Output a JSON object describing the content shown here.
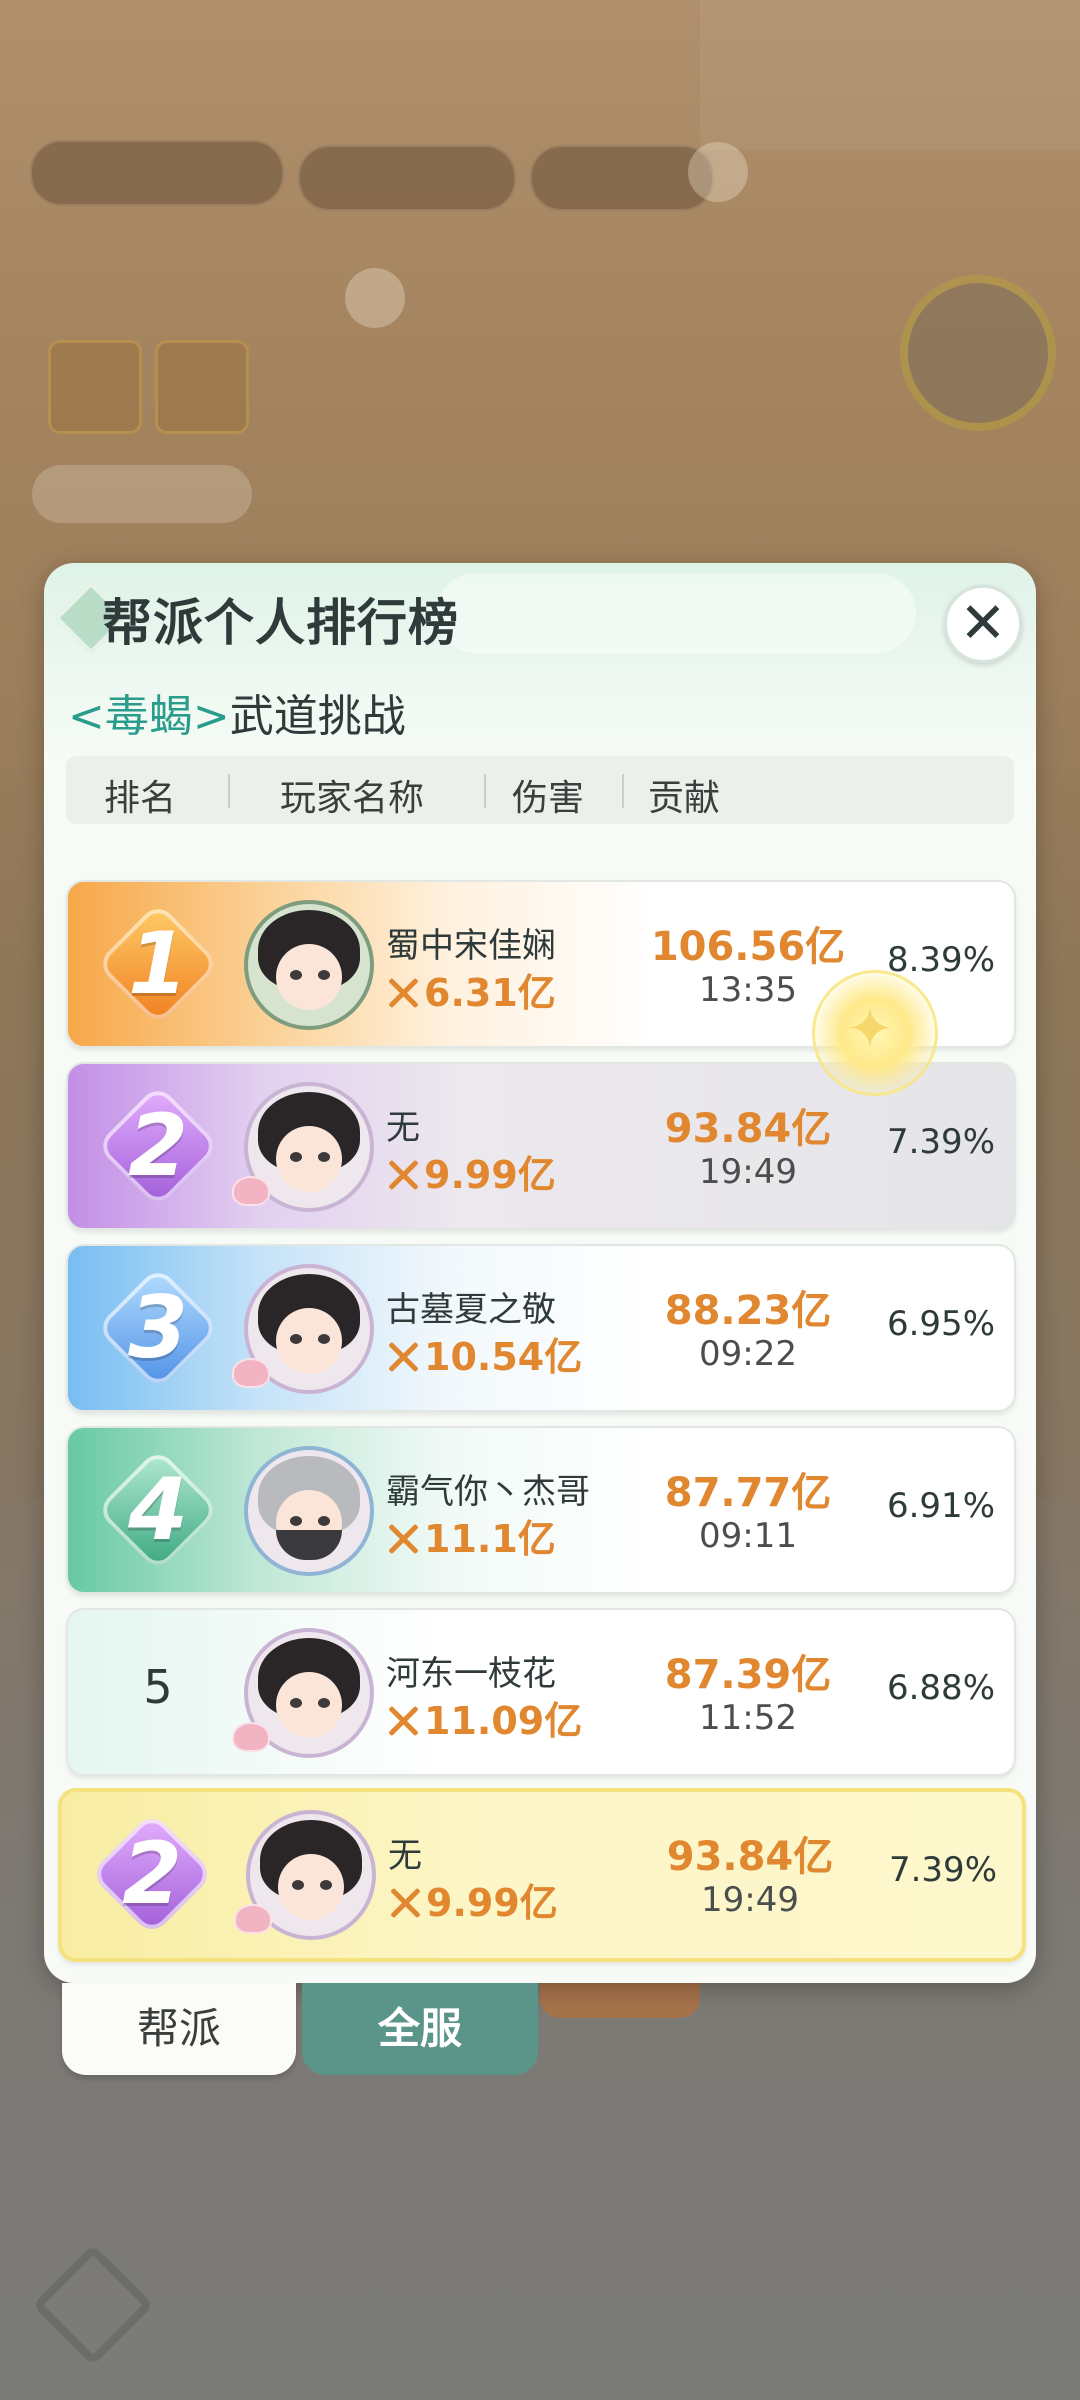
{
  "panel": {
    "title": "帮派个人排行榜",
    "subtitle_boss": "<毒蝎>",
    "subtitle_mode": "武道挑战",
    "close_icon": "close-icon"
  },
  "columns": {
    "rank": "排名",
    "player_name": "玩家名称",
    "damage": "伤害",
    "contribution": "贡献"
  },
  "rows": [
    {
      "rank": "1",
      "name": "蜀中宋佳娴",
      "power": "6.31亿",
      "damage": "106.56亿",
      "time": "13:35",
      "contribution": "8.39%"
    },
    {
      "rank": "2",
      "name": "无",
      "power": "9.99亿",
      "damage": "93.84亿",
      "time": "19:49",
      "contribution": "7.39%"
    },
    {
      "rank": "3",
      "name": "古墓夏之敬",
      "power": "10.54亿",
      "damage": "88.23亿",
      "time": "09:22",
      "contribution": "6.95%"
    },
    {
      "rank": "4",
      "name": "霸气你丶杰哥",
      "power": "11.1亿",
      "damage": "87.77亿",
      "time": "09:11",
      "contribution": "6.91%"
    },
    {
      "rank": "5",
      "name": "河东一枝花",
      "power": "11.09亿",
      "damage": "87.39亿",
      "time": "11:52",
      "contribution": "6.88%"
    }
  ],
  "self_row": {
    "rank": "2",
    "name": "无",
    "power": "9.99亿",
    "damage": "93.84亿",
    "time": "19:49",
    "contribution": "7.39%"
  },
  "tabs": {
    "guild": "帮派",
    "server": "全服",
    "active": "server"
  },
  "colors": {
    "damage": "#e08730",
    "accent": "#2a9c8b",
    "active_tab": "#5b958a"
  }
}
